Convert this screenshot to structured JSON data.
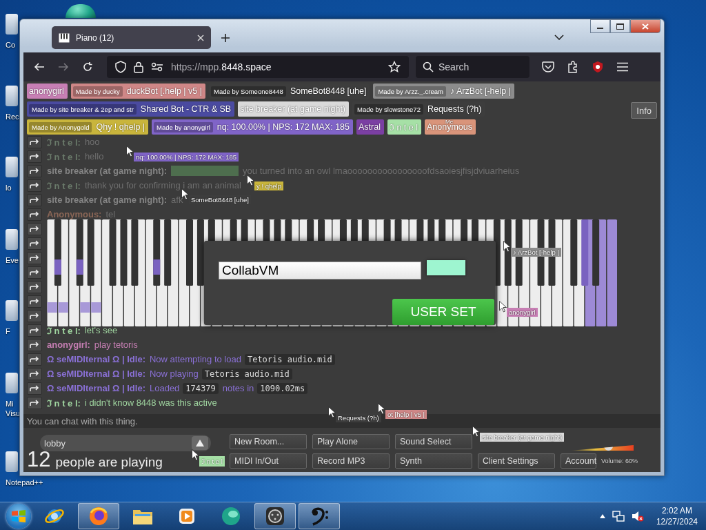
{
  "desktop": {
    "icons": [
      {
        "label": "Co"
      },
      {
        "label": "Rec"
      },
      {
        "label": "lo"
      },
      {
        "label": "Eve"
      },
      {
        "label": "F"
      },
      {
        "label": "Mi Visu"
      },
      {
        "label": "Notepad++"
      }
    ]
  },
  "browser": {
    "tab": {
      "title": "Piano (12)",
      "selected": true
    },
    "address": {
      "dim": "https://mpp.",
      "host": "8448.space"
    },
    "search": {
      "placeholder": "Search"
    }
  },
  "users": [
    [
      {
        "name": "anonygirl",
        "color": "#c77fb4"
      },
      {
        "made_by": "Made by ducky",
        "name": "duckBot [.help | v5 |",
        "color": "#cf8787"
      },
      {
        "made_by": "Made by Someone8448",
        "name": "SomeBot8448 [uhe]",
        "color": "#3d3d3d"
      },
      {
        "made_by": "Made by Arzz._.cream",
        "name": "♪ ArzBot [-help |",
        "color": "#8c8c8c"
      }
    ],
    [
      {
        "made_by": "Made by site breaker & 2ep and str",
        "name": "Shared Bot - CTR & SB",
        "color": "#4a4aa0"
      },
      {
        "name": "site breaker (at game night)",
        "color": "#d9d9d9"
      },
      {
        "made_by": "Made by slowstone72",
        "name": "Requests (?h)",
        "color": "#3d3d3d"
      }
    ],
    [
      {
        "made_by": "Made by Anonygold",
        "name": "Qhy ! qhelp |",
        "color": "#c9b53c"
      },
      {
        "made_by": "Made by anonygirl",
        "name": "nq: 100.00% | NPS: 172 MAX: 185",
        "color": "#8064c8"
      },
      {
        "name": "Astral",
        "color": "#7b3fa3"
      },
      {
        "name": "ℑ n t e l",
        "color": "#a6e0a6"
      },
      {
        "name": "Anonymous",
        "badge": "Me",
        "color": "#d9947a"
      }
    ]
  ],
  "info_button": "Info",
  "chat": {
    "older": [
      {
        "name": "ℑ n t e l:",
        "color": "#6a7a6a",
        "parts": [
          {
            "kind": "text",
            "text": "hoo"
          }
        ]
      },
      {
        "name": "ℑ n t e l:",
        "color": "#6a7a6a",
        "parts": [
          {
            "kind": "text",
            "text": "hello"
          }
        ]
      },
      {
        "name": "site breaker (at game night):",
        "color": "#858585",
        "parts": [
          {
            "kind": "spoiler"
          },
          {
            "kind": "text",
            "text": "you turned into an owl lmaoooooooooooooooofdsaoiesjfisjdviuarheius"
          }
        ]
      },
      {
        "name": "ℑ n t e l:",
        "color": "#6a7a6a",
        "parts": [
          {
            "kind": "text",
            "text": "thank you for confirming i am an animal"
          }
        ]
      },
      {
        "name": "site breaker (at game night):",
        "color": "#858585",
        "parts": [
          {
            "kind": "text",
            "text": "afk"
          }
        ]
      },
      {
        "name": "Anonymous:",
        "color": "#8a6656",
        "parts": [
          {
            "kind": "text",
            "text": "tel"
          }
        ]
      }
    ],
    "recent": [
      {
        "name": "ℑ n t e l:",
        "color": "#9fd49f",
        "parts": [
          {
            "kind": "text",
            "text": "let's see"
          }
        ]
      },
      {
        "name": "anonygirl:",
        "color": "#c77fb4",
        "parts": [
          {
            "kind": "text",
            "text": "play tetoris"
          }
        ]
      },
      {
        "name": "Ω seMIDIternal Ω | Idle:",
        "color": "#8a70d6",
        "parts": [
          {
            "kind": "text",
            "text": "Now attempting to load"
          },
          {
            "kind": "code",
            "text": "Tetoris audio.mid"
          }
        ]
      },
      {
        "name": "Ω seMIDIternal Ω | Idle:",
        "color": "#8a70d6",
        "parts": [
          {
            "kind": "text",
            "text": "Now playing"
          },
          {
            "kind": "code",
            "text": "Tetoris audio.mid"
          }
        ]
      },
      {
        "name": "Ω seMIDIternal Ω | Idle:",
        "color": "#8a70d6",
        "parts": [
          {
            "kind": "text",
            "text": "Loaded"
          },
          {
            "kind": "code",
            "text": "174379"
          },
          {
            "kind": "text",
            "text": "notes in"
          },
          {
            "kind": "code",
            "text": "1090.02ms"
          }
        ]
      },
      {
        "name": "ℑ n t e l:",
        "color": "#9fd49f",
        "parts": [
          {
            "kind": "text",
            "text": "i didn't know 8448 was this active"
          }
        ]
      }
    ],
    "input_placeholder": "You can chat with this thing."
  },
  "dialog": {
    "name": "CollabVM",
    "color": "#9ef5d0",
    "button": "USER SET"
  },
  "cursors": [
    {
      "label": "nq: 100.00% | NPS: 172 MAX: 185",
      "color": "#8064c8"
    },
    {
      "label": "y ! qhelp",
      "color": "#c9b53c"
    },
    {
      "label": "SomeBot8448 [uhe]",
      "color": "#3d3d3d"
    },
    {
      "label": "♪ ArzBot [-help |",
      "color": "#8c8c8c"
    },
    {
      "label": "anonygirl",
      "color": "#c77fb4"
    },
    {
      "label": "ot [help | v5 |",
      "color": "#cf8787"
    },
    {
      "label": "Requests (?h)",
      "color": "#3d3d3d"
    },
    {
      "label": "site breaker (at game night)",
      "color": "#d9d9d9"
    },
    {
      "label": "ℑ n t e l",
      "color": "#a6e0a6"
    }
  ],
  "room": {
    "name": "lobby"
  },
  "players": {
    "count": "12",
    "label": "people are playing"
  },
  "buttons": [
    {
      "label": "New Room..."
    },
    {
      "label": "Play Alone"
    },
    {
      "label": "Sound Select"
    },
    {
      "label": "MIDI In/Out"
    },
    {
      "label": "Record MP3"
    },
    {
      "label": "Synth"
    },
    {
      "label": "Client Settings"
    },
    {
      "label": "Account"
    }
  ],
  "volume": {
    "level": 0.6,
    "label": "Volume: 60%"
  },
  "taskbar": {
    "items": [
      {
        "running": false
      },
      {
        "running": true
      },
      {
        "running": false
      },
      {
        "running": false
      },
      {
        "running": false
      },
      {
        "running": true
      },
      {
        "running": true
      }
    ],
    "time": "2:02 AM",
    "date": "12/27/2024"
  }
}
